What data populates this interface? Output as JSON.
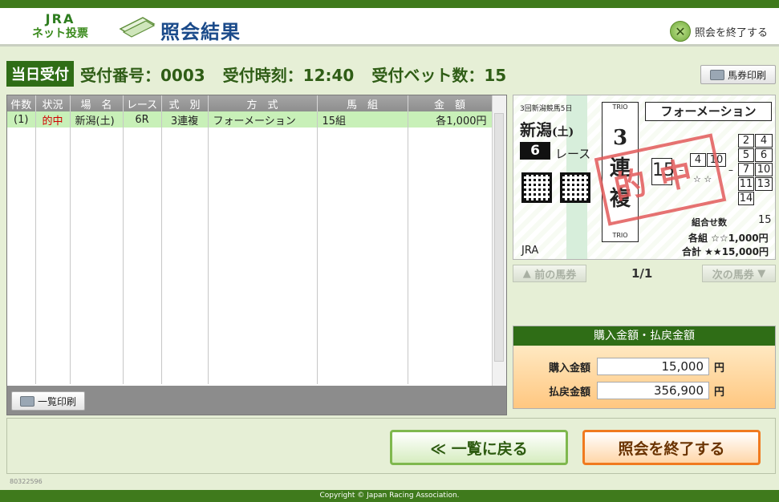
{
  "header": {
    "logo_line1": "JRA",
    "logo_line2": "ネット投票",
    "title": "照会結果",
    "exit_label": "照会を終了する"
  },
  "receipt": {
    "same_day_label": "当日受付",
    "number_label": "受付番号：0003",
    "time_label": "受付時刻：12:40",
    "bet_count_label": "受付ベット数：15"
  },
  "buttons": {
    "ticket_print": "馬券印刷",
    "list_print": "一覧印刷",
    "prev_ticket": "前の馬券",
    "next_ticket": "次の馬券",
    "back_to_list": "≪ 一覧に戻る",
    "end_inquiry": "照会を終了する"
  },
  "table": {
    "headers": [
      "件数",
      "状況",
      "場　名",
      "レース",
      "式　別",
      "方　式",
      "馬　組",
      "金　額"
    ],
    "rows": [
      {
        "count": "(1)",
        "status": "的中",
        "venue": "新潟(土)",
        "race": "6R",
        "type": "3連複",
        "method": "フォーメーション",
        "combo": "15組",
        "amount": "各1,000円"
      }
    ]
  },
  "ticket": {
    "meet": "3回新潟競馬5日",
    "venue": "新潟",
    "day": "(土)",
    "race_no": "6",
    "race_label": "レース",
    "trio": "TRIO",
    "bet_type_chars": [
      "3",
      "連",
      "複"
    ],
    "method": "フォーメーション",
    "first": "15",
    "second": [
      "4",
      "10"
    ],
    "third": [
      "2",
      "4",
      "5",
      "6",
      "7",
      "10",
      "11",
      "13",
      "14"
    ],
    "stamp": "的中",
    "combos_label": "組合せ数",
    "combos_value": "15",
    "each_label": "各組 ☆☆1,000円",
    "total_label": "合計 ★★15,000円",
    "jra": "JRA",
    "page": "1/1"
  },
  "amount": {
    "title": "購入金額・払戻金額",
    "purchase_label": "購入金額",
    "purchase_value": "15,000",
    "refund_label": "払戻金額",
    "refund_value": "356,900",
    "yen": "円"
  },
  "footer": {
    "code": "80322596",
    "copyright": "Copyright © Japan Racing Association."
  }
}
